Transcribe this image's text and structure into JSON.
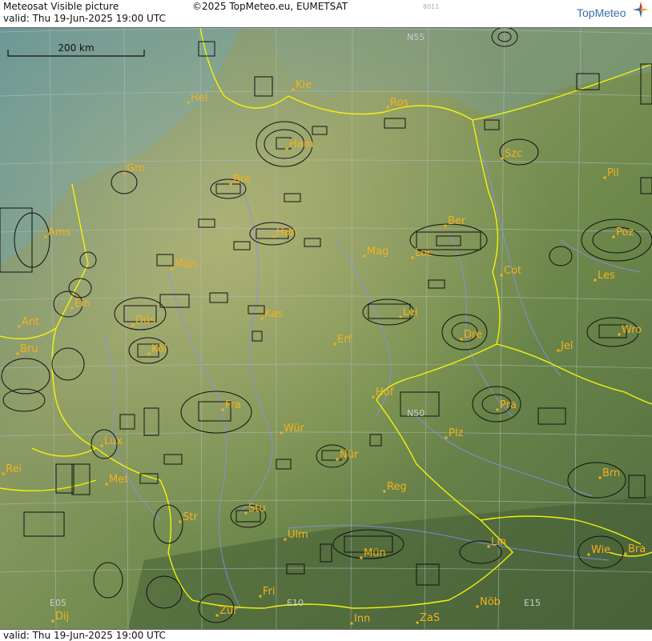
{
  "header": {
    "title": "Meteosat Visible picture",
    "copyright": "©2025 TopMeteo.eu, EUMETSAT",
    "valid": "valid:  Thu  19-Jun-2025  19:00 UTC",
    "code": "8011",
    "logo_text": "TopMeteo"
  },
  "footer": {
    "valid": "valid:  Thu  19-Jun-2025  19:00 UTC"
  },
  "scale": {
    "label": "200 km"
  },
  "grid_labels": {
    "n55": "N55",
    "n50": "N50",
    "e05": "E05",
    "e10": "E10",
    "e15": "E15"
  },
  "cities": [
    {
      "name": "Kie"
    },
    {
      "name": "Hel"
    },
    {
      "name": "Ros"
    },
    {
      "name": "Ham"
    },
    {
      "name": "Szc"
    },
    {
      "name": "Gro"
    },
    {
      "name": "Bre"
    },
    {
      "name": "Pil"
    },
    {
      "name": "Ber"
    },
    {
      "name": "Ams"
    },
    {
      "name": "Han"
    },
    {
      "name": "Poz"
    },
    {
      "name": "Mün"
    },
    {
      "name": "Mag"
    },
    {
      "name": "Loc"
    },
    {
      "name": "Cot"
    },
    {
      "name": "Les"
    },
    {
      "name": "Ein"
    },
    {
      "name": "Kas"
    },
    {
      "name": "Lei"
    },
    {
      "name": "Ant"
    },
    {
      "name": "Düs"
    },
    {
      "name": "Wro"
    },
    {
      "name": "Dre"
    },
    {
      "name": "Bru"
    },
    {
      "name": "Köl"
    },
    {
      "name": "Erf"
    },
    {
      "name": "Jel"
    },
    {
      "name": "Hof"
    },
    {
      "name": "Fra"
    },
    {
      "name": "Pra"
    },
    {
      "name": "Wür"
    },
    {
      "name": "Lux"
    },
    {
      "name": "Plz"
    },
    {
      "name": "Nür"
    },
    {
      "name": "Rei"
    },
    {
      "name": "Met"
    },
    {
      "name": "Reg"
    },
    {
      "name": "Brn"
    },
    {
      "name": "Stu"
    },
    {
      "name": "Str"
    },
    {
      "name": "Ulm"
    },
    {
      "name": "Lin"
    },
    {
      "name": "Mün"
    },
    {
      "name": "Wie"
    },
    {
      "name": "Bra"
    },
    {
      "name": "Fri"
    },
    {
      "name": "Nöb"
    },
    {
      "name": "Dij"
    },
    {
      "name": "Zür"
    },
    {
      "name": "Inn"
    },
    {
      "name": "ZaS"
    }
  ],
  "colors": {
    "city": "#f4b11c",
    "border": "#f2f20a",
    "river": "#8a8ef0",
    "grid": "#b8bcc8"
  }
}
